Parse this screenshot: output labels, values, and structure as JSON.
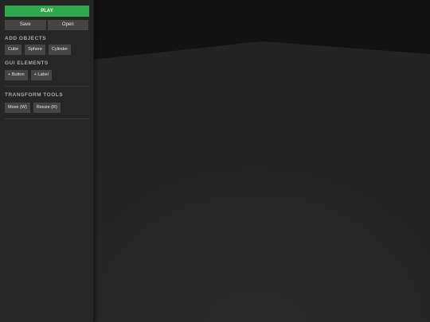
{
  "toolbar": {
    "play_label": "PLAY",
    "save_label": "Save",
    "open_label": "Open"
  },
  "sections": {
    "add_objects": {
      "title": "ADD OBJECTS",
      "items": [
        "Cube",
        "Sphere",
        "Cylinder"
      ]
    },
    "gui_elements": {
      "title": "GUI ELEMENTS",
      "items": [
        "+ Button",
        "+ Label"
      ]
    },
    "transform_tools": {
      "title": "TRANSFORM TOOLS",
      "items": [
        "Move (W)",
        "Resize (R)"
      ]
    }
  },
  "colors": {
    "play": "#2ea84a",
    "sidebar": "#262626",
    "button": "#454545",
    "viewport_sky": "#141414",
    "viewport_floor": "#252525"
  }
}
